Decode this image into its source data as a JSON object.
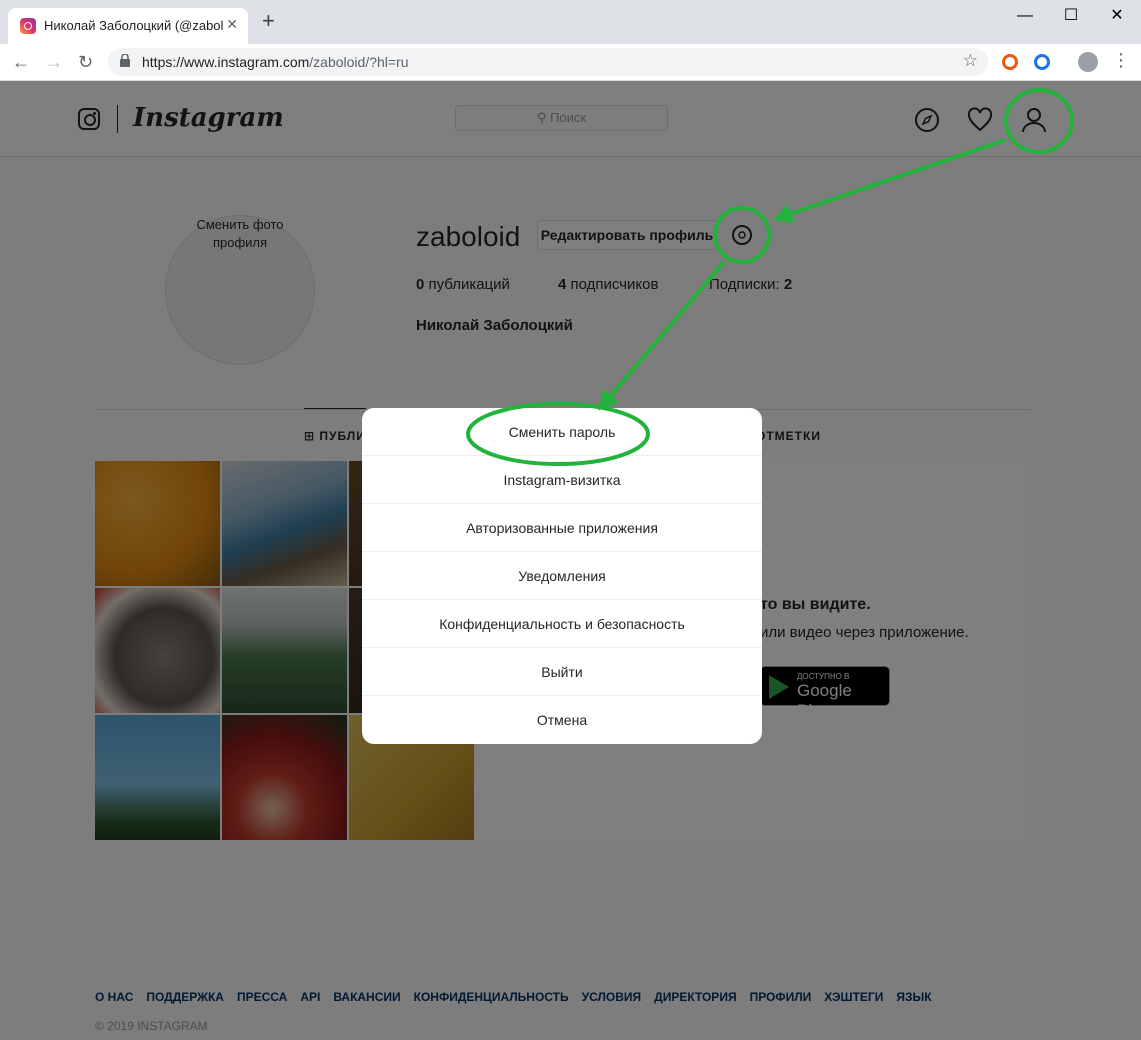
{
  "browser": {
    "tab_title": "Николай Заболоцкий (@zaboloid)",
    "tab_close": "✕",
    "new_tab": "+",
    "url_main": "https://www.instagram.com",
    "url_path": "/zaboloid/?hl=ru",
    "win_min": "—",
    "win_max": "☐",
    "win_close": "✕"
  },
  "header": {
    "wordmark": "Instagram",
    "search_placeholder": "Поиск",
    "search_icon": "⚲"
  },
  "profile": {
    "avatar_text": "Сменить фото профиля",
    "username": "zaboloid",
    "edit_button": "Редактировать профиль",
    "posts_count": "0",
    "posts_label": "публикаций",
    "followers_count": "4",
    "followers_label": "подписчиков",
    "following_label": "Подписки:",
    "following_count": "2",
    "full_name": "Николай Заболоцкий"
  },
  "tabs": {
    "posts": "⊞ ПУБЛИКАЦИИ",
    "tagged": "ОТМЕТКИ"
  },
  "promo": {
    "title": "то вы видите.",
    "text": "или видео через приложение.",
    "gplay_small": "ДОСТУПНО В",
    "gplay_big": "Google Play"
  },
  "settings_menu": {
    "items": [
      "Сменить пароль",
      "Instagram-визитка",
      "Авторизованные приложения",
      "Уведомления",
      "Конфиденциальность и безопасность",
      "Выйти",
      "Отмена"
    ]
  },
  "footer": {
    "links": [
      "О НАС",
      "ПОДДЕРЖКА",
      "ПРЕССА",
      "API",
      "ВАКАНСИИ",
      "КОНФИДЕНЦИАЛЬНОСТЬ",
      "УСЛОВИЯ",
      "ДИРЕКТОРИЯ",
      "ПРОФИЛИ",
      "ХЭШТЕГИ",
      "ЯЗЫК"
    ],
    "copyright": "© 2019 INSTAGRAM"
  },
  "colors": {
    "annotation_green": "#22b33a",
    "link_blue": "#003569"
  }
}
